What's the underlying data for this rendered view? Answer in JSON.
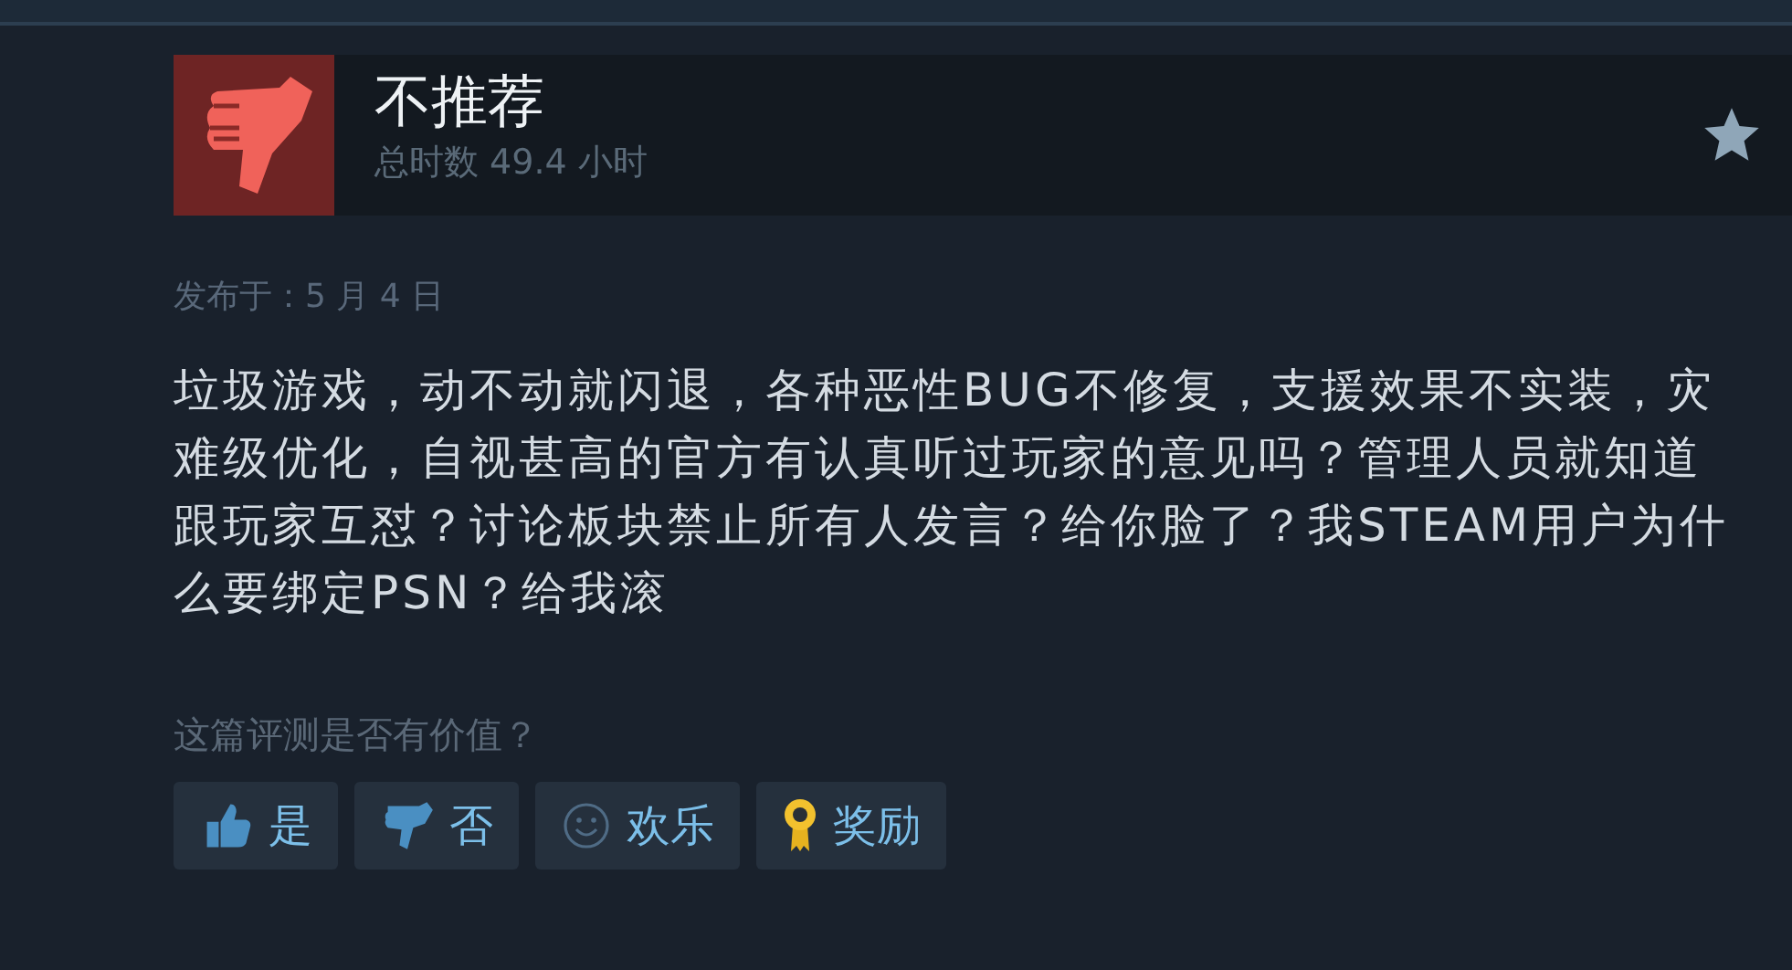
{
  "review": {
    "recommended": false,
    "verdict": "不推荐",
    "playtime": "总时数 49.4 小时",
    "posted": "发布于：5 月 4 日",
    "body": "垃圾游戏，动不动就闪退，各种恶性BUG不修复，支援效果不实装，灾难级优化，自视甚高的官方有认真听过玩家的意见吗？管理人员就知道跟玩家互怼？讨论板块禁止所有人发言？给你脸了？我STEAM用户为什么要绑定PSN？给我滚"
  },
  "helpful": {
    "question": "这篇评测是否有价值？",
    "buttons": [
      {
        "kind": "yes",
        "label": "是"
      },
      {
        "kind": "no",
        "label": "否"
      },
      {
        "kind": "funny",
        "label": "欢乐"
      },
      {
        "kind": "award",
        "label": "奖励"
      }
    ]
  }
}
